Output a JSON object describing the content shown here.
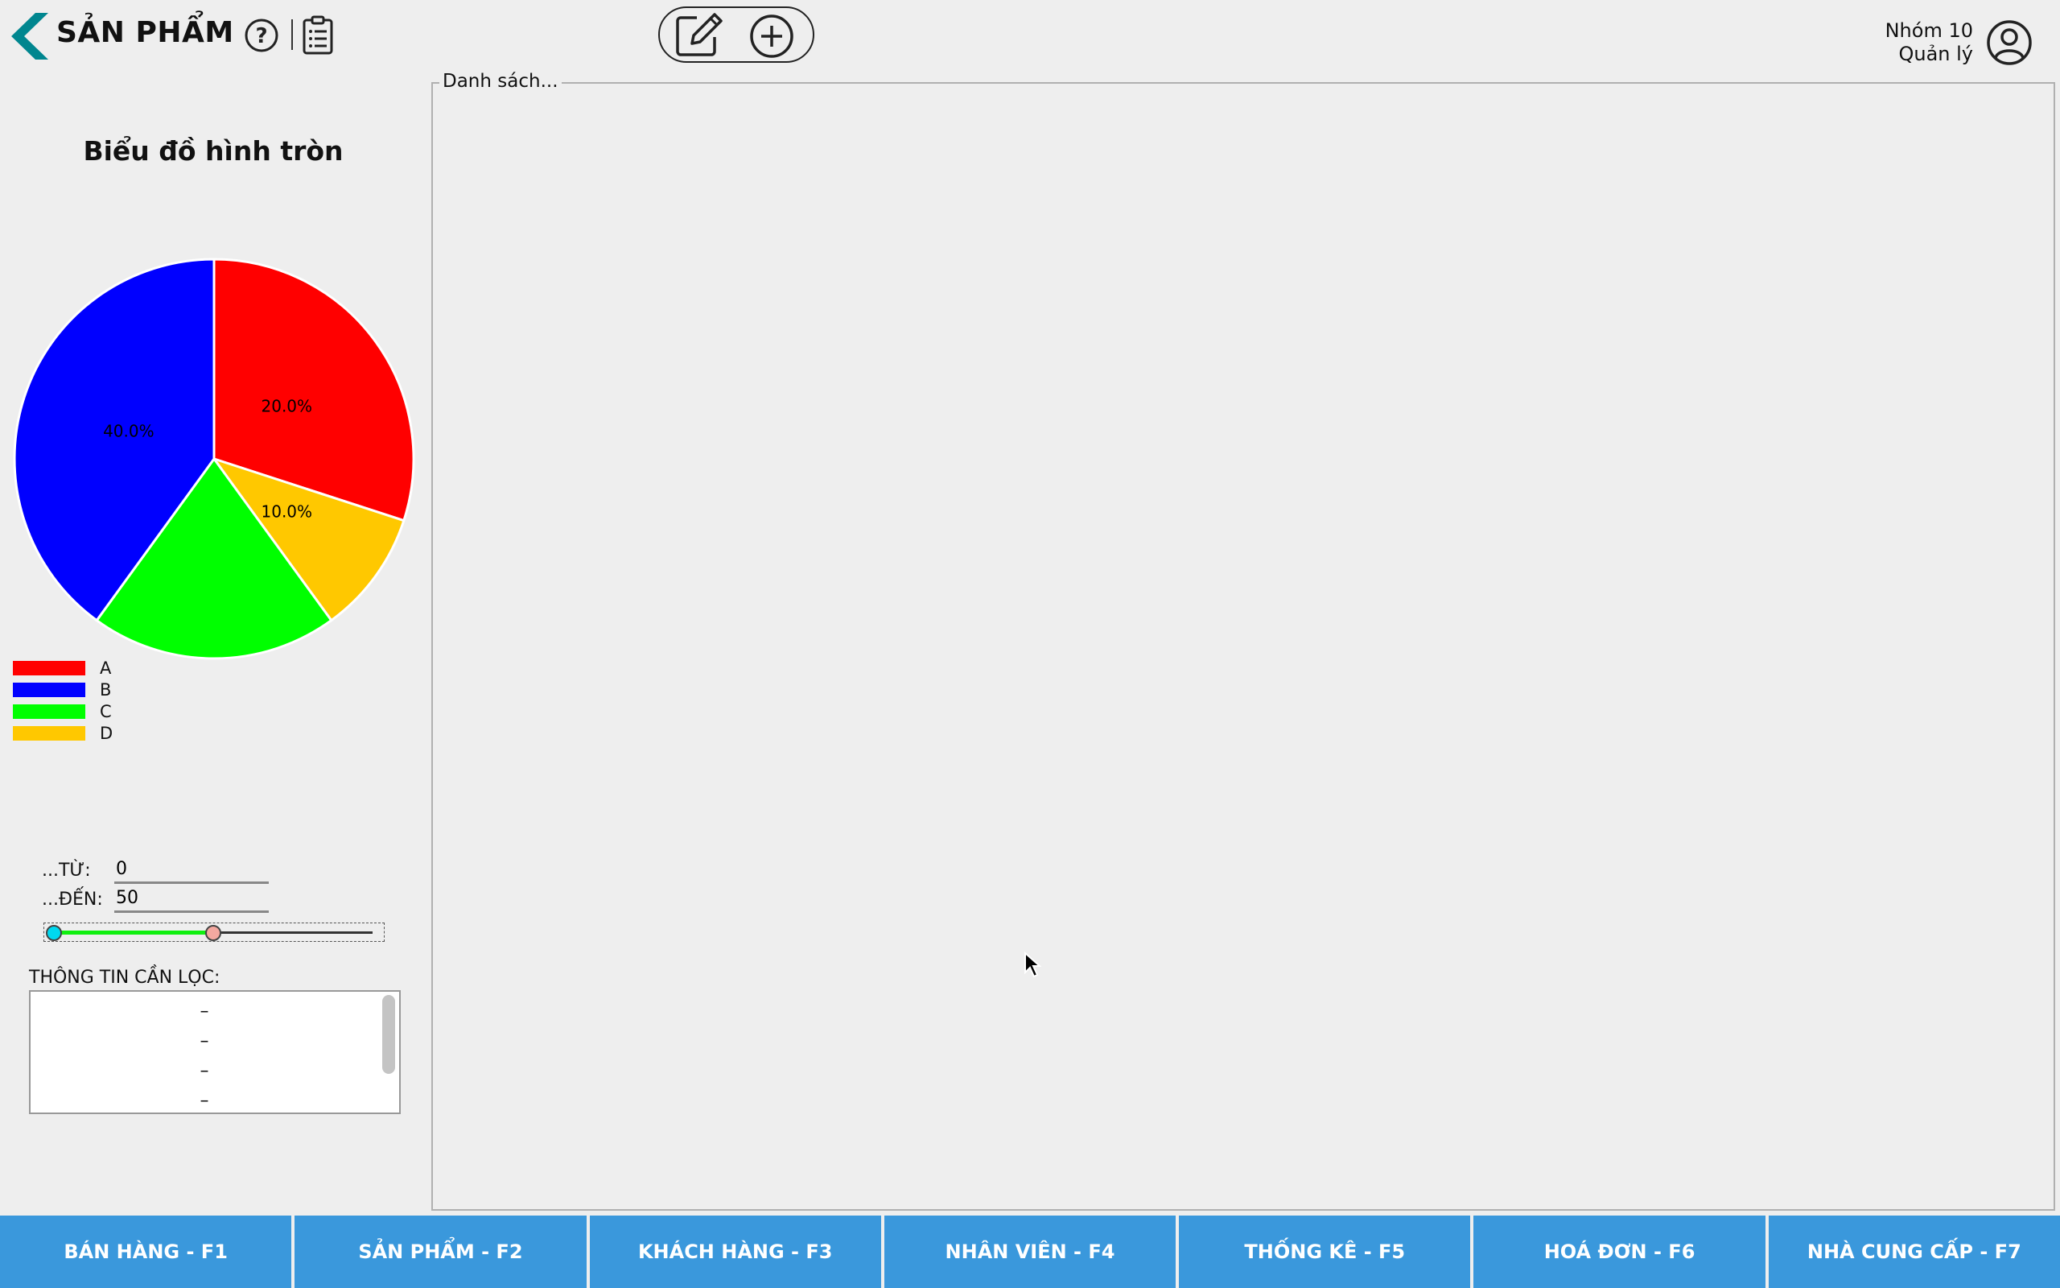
{
  "header": {
    "title": "SẢN PHẨM",
    "user_group": "Nhóm 10",
    "user_role": "Quản lý"
  },
  "icons": {
    "back": "back-chevron-icon",
    "help": "help-icon",
    "list": "clipboard-list-icon",
    "edit": "edit-icon",
    "add": "add-circle-icon",
    "avatar": "user-avatar-icon"
  },
  "chart_data": {
    "type": "pie",
    "title": "Biểu đồ hình tròn",
    "slices": [
      {
        "label": "A",
        "value": 30,
        "color": "#ff0000",
        "data_label": "20.0%"
      },
      {
        "label": "D",
        "value": 10,
        "color": "#ffc800",
        "data_label": "10.0%"
      },
      {
        "label": "C",
        "value": 20,
        "color": "#00ff00",
        "data_label": ""
      },
      {
        "label": "B",
        "value": 40,
        "color": "#0000ff",
        "data_label": "40.0%"
      }
    ],
    "legend": [
      {
        "label": "A",
        "color": "#ff0000"
      },
      {
        "label": "B",
        "color": "#0000ff"
      },
      {
        "label": "C",
        "color": "#00ff00"
      },
      {
        "label": "D",
        "color": "#ffc800"
      }
    ],
    "legend_placement": "bottom-left"
  },
  "filter": {
    "from_label": "...TỪ:",
    "from_value": "0",
    "to_label": "...ĐẾN:",
    "to_value": "50",
    "slider_low_fraction": 0.0,
    "slider_high_fraction": 0.5,
    "slider_colors": {
      "low_knob": "#00d8f0",
      "high_knob": "#f4a8a0",
      "fill": "#10f010"
    },
    "info_title": "THÔNG TIN CẦN LỌC:",
    "info_items": [
      "–",
      "–",
      "–",
      "–"
    ]
  },
  "list_panel": {
    "title": "Danh sách..."
  },
  "nav": [
    "BÁN HÀNG - F1",
    "SẢN PHẨM - F2",
    "KHÁCH HÀNG - F3",
    "NHÂN VIÊN - F4",
    "THỐNG KÊ - F5",
    "HOÁ ĐƠN - F6",
    "NHÀ CUNG CẤP - F7"
  ],
  "colors": {
    "accent": "#3a98dc",
    "back_chevron": "#00868f",
    "background": "#eeeeee"
  }
}
